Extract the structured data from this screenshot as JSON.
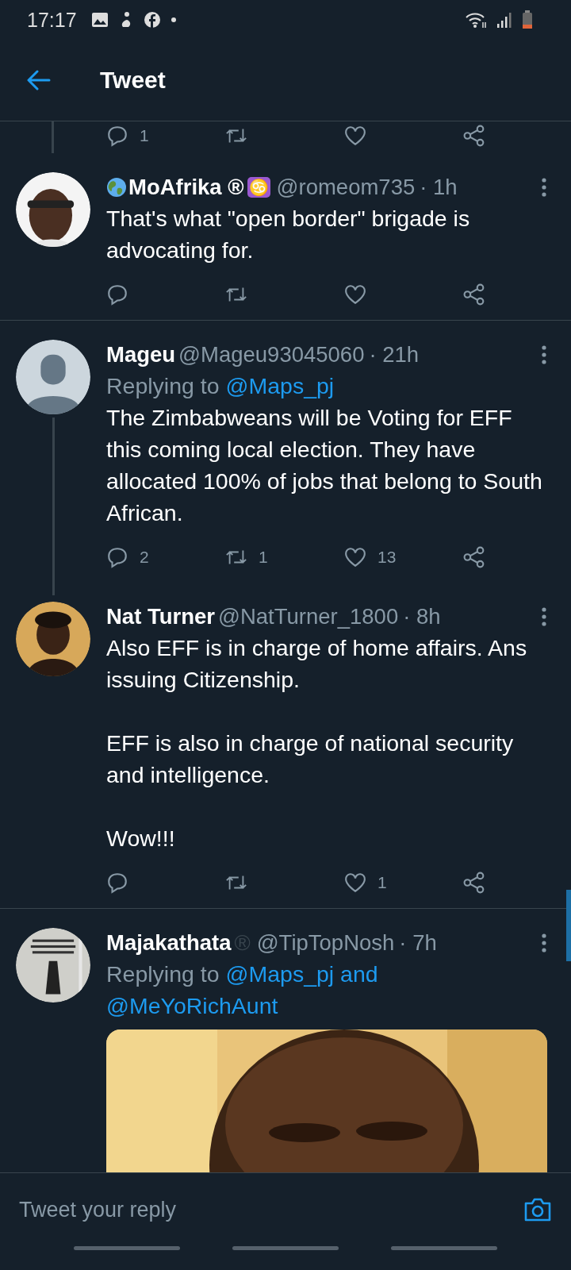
{
  "status_bar": {
    "time": "17:17"
  },
  "header": {
    "title": "Tweet"
  },
  "previous_actions": {
    "thread_line": true,
    "reply_count": "1"
  },
  "tweets": [
    {
      "avatar": {
        "kind": "face"
      },
      "name": "MoAfrika ®",
      "leading_icon": {
        "kind": "globe"
      },
      "trailing_symbol": "♋",
      "handle": "@romeom735",
      "time": "· 1h",
      "thread_below": false,
      "body": [
        "That's what \"open border\" brigade is advocating for."
      ],
      "actions": {
        "shown": true
      }
    },
    {
      "avatar": {
        "kind": "default"
      },
      "name": "Mageu",
      "handle": "@Mageu93045060",
      "time": "· 21h",
      "replying": {
        "prefix": "Replying to",
        "mentions": [
          "@Maps_pj"
        ]
      },
      "thread_below": true,
      "body": [
        "The Zimbabweans will be Voting for EFF this coming local election. They have allocated 100%  of jobs that belong to South African."
      ],
      "actions": {
        "shown": true,
        "replies": "2",
        "retweets": "1",
        "likes": "13"
      }
    },
    {
      "avatar": {
        "kind": "portrait"
      },
      "name": "Nat Turner",
      "handle": "@NatTurner_1800",
      "time": "· 8h",
      "thread_below": false,
      "body": [
        "Also EFF is in charge of home affairs. Ans issuing Citizenship.",
        "EFF is also in charge of national security and intelligence.",
        "Wow!!!"
      ],
      "actions": {
        "shown": true,
        "likes": "1"
      }
    },
    {
      "avatar": {
        "kind": "poster"
      },
      "name": "Majakathata",
      "muted_mark": "®",
      "handle": "@TipTopNosh",
      "time": "· 7h",
      "replying": {
        "prefix": "Replying to",
        "mentions": [
          "@Maps_pj and",
          "@MeYoRichAunt"
        ]
      },
      "thread_below": false
    }
  ],
  "reply_bar": {
    "placeholder": "Tweet your reply"
  }
}
